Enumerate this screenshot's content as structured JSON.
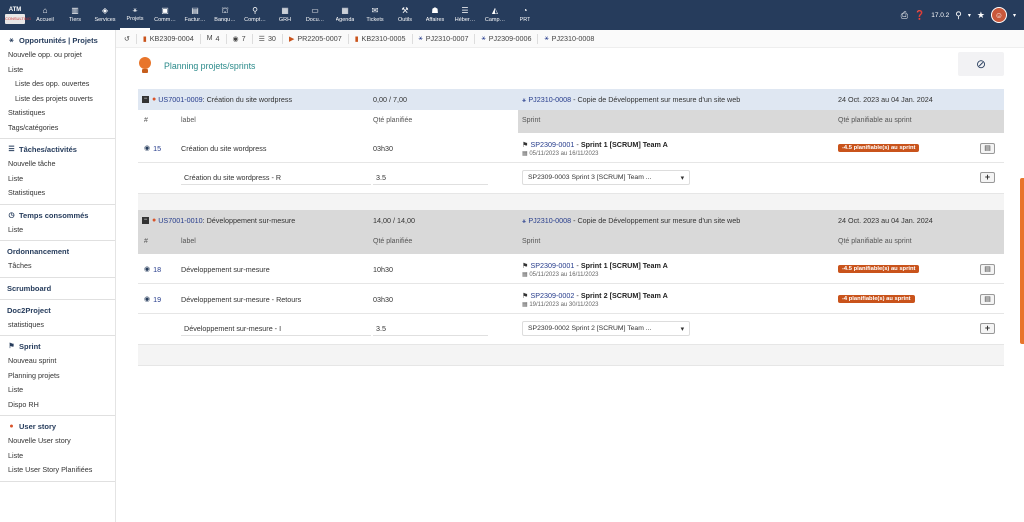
{
  "topbar": {
    "logo_text": "ATM",
    "logo_sub": "CONSULTING",
    "menu": [
      {
        "label": "Accueil",
        "icon": "home-icon",
        "glyph": "⌂"
      },
      {
        "label": "Tiers",
        "icon": "building-icon",
        "glyph": "▥"
      },
      {
        "label": "Services",
        "icon": "cube-icon",
        "glyph": "◈"
      },
      {
        "label": "Projets",
        "icon": "project-icon",
        "glyph": "⚹"
      },
      {
        "label": "Comm…",
        "icon": "commerce-icon",
        "glyph": "▣"
      },
      {
        "label": "Factur…",
        "icon": "invoice-icon",
        "glyph": "▤"
      },
      {
        "label": "Banqu…",
        "icon": "bank-icon",
        "glyph": "⛫"
      },
      {
        "label": "Compt…",
        "icon": "search-icon",
        "glyph": "⚲"
      },
      {
        "label": "GRH",
        "icon": "hr-icon",
        "glyph": "▦"
      },
      {
        "label": "Docu…",
        "icon": "document-icon",
        "glyph": "▭"
      },
      {
        "label": "Agenda",
        "icon": "calendar-icon",
        "glyph": "▦"
      },
      {
        "label": "Tickets",
        "icon": "ticket-icon",
        "glyph": "✉"
      },
      {
        "label": "Outils",
        "icon": "wrench-icon",
        "glyph": "⚒"
      },
      {
        "label": "Affaires",
        "icon": "people-icon",
        "glyph": "☗"
      },
      {
        "label": "Héber…",
        "icon": "server-icon",
        "glyph": "☰"
      },
      {
        "label": "Camp…",
        "icon": "megaphone-icon",
        "glyph": "◭"
      },
      {
        "label": "PRT",
        "icon": "gauge-icon",
        "glyph": "◔"
      }
    ],
    "version": "17.0.2"
  },
  "sidebar": {
    "sections": [
      {
        "title": "Opportunités | Projets",
        "icon": "project-icon",
        "glyph": "⚹",
        "items": [
          {
            "label": "Nouvelle opp. ou projet",
            "sub": false
          },
          {
            "label": "Liste",
            "sub": false
          },
          {
            "label": "Liste des opp. ouvertes",
            "sub": true
          },
          {
            "label": "Liste des projets ouverts",
            "sub": true
          },
          {
            "label": "Statistiques",
            "sub": false
          },
          {
            "label": "Tags/catégories",
            "sub": false
          }
        ]
      },
      {
        "title": "Tâches/activités",
        "icon": "tasks-icon",
        "glyph": "☰",
        "items": [
          {
            "label": "Nouvelle tâche",
            "sub": false
          },
          {
            "label": "Liste",
            "sub": false
          },
          {
            "label": "Statistiques",
            "sub": false
          }
        ]
      },
      {
        "title": "Temps consommés",
        "icon": "clock-icon",
        "glyph": "◷",
        "items": [
          {
            "label": "Liste",
            "sub": false
          }
        ]
      },
      {
        "title": "Ordonnancement",
        "icon": "",
        "glyph": "",
        "items": [
          {
            "label": "Tâches",
            "sub": false
          }
        ]
      },
      {
        "title": "Scrumboard",
        "icon": "",
        "glyph": "",
        "items": []
      },
      {
        "title": "Doc2Project",
        "icon": "",
        "glyph": "",
        "items": [
          {
            "label": "statistiques",
            "sub": false
          }
        ]
      },
      {
        "title": "Sprint",
        "icon": "runner-icon",
        "glyph": "🏃",
        "items": [
          {
            "label": "Nouveau sprint",
            "sub": false
          },
          {
            "label": "Planning projets",
            "sub": false
          },
          {
            "label": "Liste",
            "sub": false
          },
          {
            "label": "Dispo RH",
            "sub": false
          }
        ]
      },
      {
        "title": "User story",
        "icon": "pin-icon",
        "glyph": "📍",
        "items": [
          {
            "label": "Nouvelle User story",
            "sub": false
          },
          {
            "label": "Liste",
            "sub": false
          },
          {
            "label": "Liste User Story Planifiées",
            "sub": false
          }
        ]
      }
    ]
  },
  "breadcrumbs": [
    {
      "label": "",
      "icon": "history-icon",
      "glyph": "↺"
    },
    {
      "label": "KB2309-0004",
      "icon": "kanban-icon",
      "glyph": "▮"
    },
    {
      "label": "4",
      "icon": "mail-icon",
      "glyph": "M"
    },
    {
      "label": "7",
      "icon": "clock-icon",
      "glyph": "◉"
    },
    {
      "label": "30",
      "icon": "list-icon",
      "glyph": "☰"
    },
    {
      "label": "PR2205-0007",
      "icon": "flag-icon",
      "glyph": "▶"
    },
    {
      "label": "KB2310-0005",
      "icon": "kanban-icon",
      "glyph": "▮"
    },
    {
      "label": "PJ2310-0007",
      "icon": "project-icon",
      "glyph": "⚹"
    },
    {
      "label": "PJ2309-0006",
      "icon": "project-icon",
      "glyph": "⚹"
    },
    {
      "label": "PJ2310-0008",
      "icon": "project-icon",
      "glyph": "⚹"
    }
  ],
  "page": {
    "title": "Planning projets/sprints"
  },
  "columns": {
    "num": "#",
    "label": "label",
    "qty": "Qté planifiée",
    "sprint": "Sprint",
    "qty_sprint": "Qté planifiable au sprint"
  },
  "blocks": [
    {
      "style": "blue",
      "story_ref": "US7001-0009",
      "story_label": " : Création du site wordpress",
      "qty": "0,00 / 7,00",
      "project_ref": "PJ2310-0008",
      "project_label": " - Copie de Développement sur mesure d'un site web",
      "dates": "24 Oct. 2023 au 04 Jan. 2024",
      "rows": [
        {
          "num": "15",
          "label": "Création du site wordpress",
          "qty": "03h30",
          "sprint_ref": "SP2309-0001",
          "sprint_name": "Sprint 1 [SCRUM] Team A",
          "sprint_dates": "05/11/2023 au 16/11/2023",
          "badge": "-4.5 planifiable(s) au sprint"
        }
      ],
      "new_row": {
        "label": "Création du site wordpress - R",
        "qty": "3.5",
        "sprint": "SP2309-0003 Sprint 3 [SCRUM] Team ..."
      }
    },
    {
      "style": "grey",
      "story_ref": "US7001-0010",
      "story_label": " : Développement sur-mesure",
      "qty": "14,00 / 14,00",
      "project_ref": "PJ2310-0008",
      "project_label": " - Copie de Développement sur mesure d'un site web",
      "dates": "24 Oct. 2023 au 04 Jan. 2024",
      "rows": [
        {
          "num": "18",
          "label": "Développement sur-mesure",
          "qty": "10h30",
          "sprint_ref": "SP2309-0001",
          "sprint_name": "Sprint 1 [SCRUM] Team A",
          "sprint_dates": "05/11/2023 au 16/11/2023",
          "badge": "-4.5 planifiable(s) au sprint"
        },
        {
          "num": "19",
          "label": "Développement sur-mesure - Retours",
          "qty": "03h30",
          "sprint_ref": "SP2309-0002",
          "sprint_name": "Sprint 2 [SCRUM] Team A",
          "sprint_dates": "19/11/2023 au 30/11/2023",
          "badge": "-4 planifiable(s) au sprint"
        }
      ],
      "new_row": {
        "label": "Développement sur-mesure - I",
        "qty": "3.5",
        "sprint": "SP2309-0002 Sprint 2 [SCRUM] Team ..."
      }
    }
  ]
}
